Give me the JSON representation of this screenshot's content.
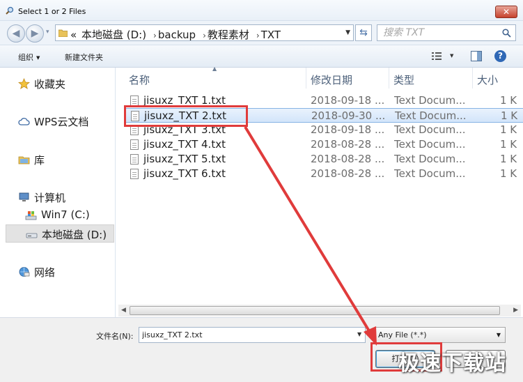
{
  "window": {
    "title": "Select 1 or 2 Files",
    "close_label": "✕"
  },
  "nav": {
    "back_label": "◀",
    "forward_label": "▶",
    "history_label": "▾"
  },
  "address": {
    "crumbs": [
      "«",
      "本地磁盘 (D:)",
      "backup",
      "教程素材",
      "TXT"
    ],
    "separator": "›"
  },
  "search": {
    "placeholder": "搜索 TXT"
  },
  "toolbar": {
    "organize_label": "组织",
    "new_folder_label": "新建文件夹"
  },
  "sidebar": {
    "items": [
      {
        "label": "收藏夹",
        "icon": "star-icon"
      },
      {
        "label": "WPS云文档",
        "icon": "cloud-icon"
      },
      {
        "label": "库",
        "icon": "library-icon"
      },
      {
        "label": "计算机",
        "icon": "computer-icon"
      },
      {
        "label": "Win7 (C:)",
        "icon": "drive-c-icon"
      },
      {
        "label": "本地磁盘 (D:)",
        "icon": "drive-d-icon"
      },
      {
        "label": "网络",
        "icon": "network-icon"
      }
    ]
  },
  "columns": {
    "name": "名称",
    "date": "修改日期",
    "type": "类型",
    "size": "大小"
  },
  "files": [
    {
      "name": "jisuxz_TXT 1.txt",
      "date": "2018-09-18 ...",
      "type": "Text Docum...",
      "size": "1 K"
    },
    {
      "name": "jisuxz_TXT 2.txt",
      "date": "2018-09-30 ...",
      "type": "Text Docum...",
      "size": "1 K"
    },
    {
      "name": "jisuxz_TXT 3.txt",
      "date": "2018-09-18 ...",
      "type": "Text Docum...",
      "size": "1 K"
    },
    {
      "name": "jisuxz_TXT 4.txt",
      "date": "2018-08-28 ...",
      "type": "Text Docum...",
      "size": "1 K"
    },
    {
      "name": "jisuxz_TXT 5.txt",
      "date": "2018-08-28 ...",
      "type": "Text Docum...",
      "size": "1 K"
    },
    {
      "name": "jisuxz_TXT 6.txt",
      "date": "2018-08-28 ...",
      "type": "Text Docum...",
      "size": "1 K"
    }
  ],
  "selected_file_index": 1,
  "bottom": {
    "filename_label": "文件名(N):",
    "filename_value": "jisuxz_TXT 2.txt",
    "filter_value": "Any File (*.*)",
    "open_label": "打开(O)",
    "cancel_label": "取消"
  },
  "watermark": "极速下载站",
  "colors": {
    "highlight": "#e03b3b",
    "selection": "#d3e5fa",
    "accent": "#2f68b6"
  }
}
